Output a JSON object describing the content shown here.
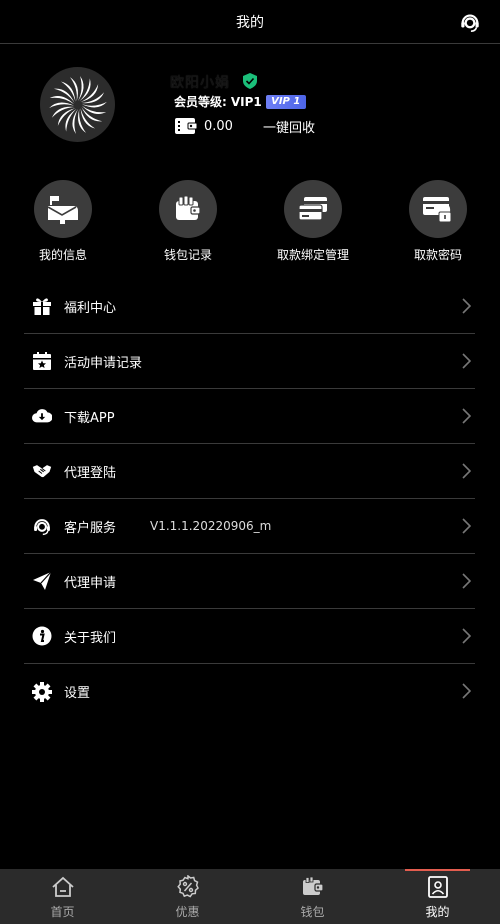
{
  "header": {
    "title": "我的",
    "support_icon": "headset-icon"
  },
  "profile": {
    "username": "欧阳小娟",
    "member_label": "会员等级:",
    "member_level": "VIP1",
    "vip_badge": "VIP 1",
    "balance": "0.00",
    "recall_label": "一键回收"
  },
  "quick_actions": [
    {
      "label": "我的信息",
      "icon": "mailbox-icon"
    },
    {
      "label": "钱包记录",
      "icon": "wallet-icon"
    },
    {
      "label": "取款绑定管理",
      "icon": "card-icon"
    },
    {
      "label": "取款密码",
      "icon": "card-lock-icon"
    }
  ],
  "menu": [
    {
      "label": "福利中心",
      "icon": "gift-icon"
    },
    {
      "label": "活动申请记录",
      "icon": "calendar-star-icon"
    },
    {
      "label": "下载APP",
      "icon": "cloud-download-icon"
    },
    {
      "label": "代理登陆",
      "icon": "handshake-icon"
    },
    {
      "label": "客户服务",
      "icon": "headset-icon",
      "version": "V1.1.1.20220906_m"
    },
    {
      "label": "代理申请",
      "icon": "paper-plane-icon"
    },
    {
      "label": "关于我们",
      "icon": "info-icon"
    },
    {
      "label": "设置",
      "icon": "gear-icon"
    }
  ],
  "bottom_nav": [
    {
      "label": "首页",
      "icon": "home-icon"
    },
    {
      "label": "优惠",
      "icon": "discount-icon"
    },
    {
      "label": "钱包",
      "icon": "wallet-icon"
    },
    {
      "label": "我的",
      "icon": "profile-icon",
      "active": true
    }
  ],
  "colors": {
    "background": "#000000",
    "divider": "#3a3a3a",
    "nav_bg": "#2b2b2b",
    "active_bar": "#e35d4f",
    "vip": "#5a70ee",
    "shield": "#1bbf7a"
  }
}
